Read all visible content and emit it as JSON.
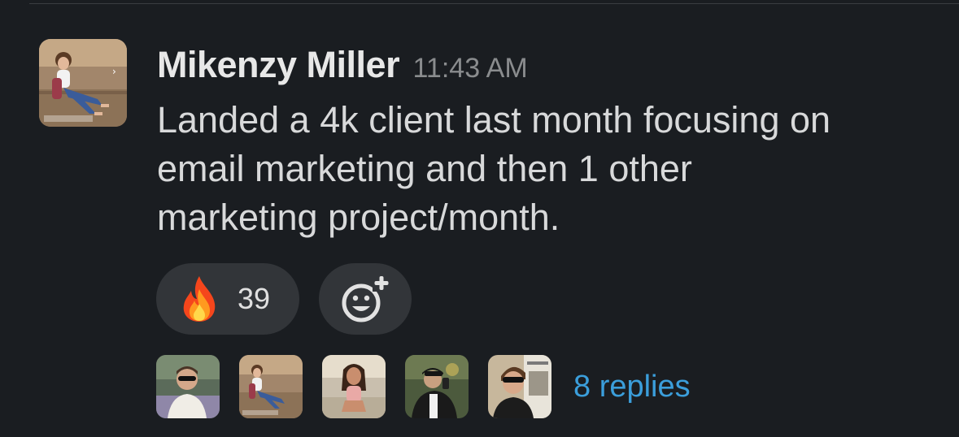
{
  "message": {
    "sender_name": "Mikenzy Miller",
    "timestamp": "11:43 AM",
    "text_lines": [
      "Landed a 4k client last month focusing on",
      "email marketing and then 1 other",
      "marketing project/month."
    ]
  },
  "reactions": [
    {
      "emoji": "fire-emoji",
      "count": "39"
    }
  ],
  "add_reaction_icon": "add-reaction-icon",
  "thread": {
    "participant_count": 5,
    "replies_label": "8 replies"
  },
  "colors": {
    "background": "#1a1d21",
    "pill": "#323539",
    "link": "#3b9edb",
    "timestamp": "#8a8c8e"
  }
}
